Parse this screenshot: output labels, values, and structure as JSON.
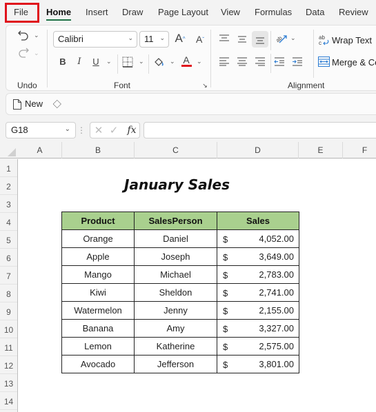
{
  "menu": {
    "tabs": [
      {
        "label": "File",
        "active": false,
        "highlighted": true
      },
      {
        "label": "Home",
        "active": true
      },
      {
        "label": "Insert"
      },
      {
        "label": "Draw"
      },
      {
        "label": "Page Layout"
      },
      {
        "label": "View"
      },
      {
        "label": "Formulas"
      },
      {
        "label": "Data"
      },
      {
        "label": "Review"
      }
    ],
    "highlight_color": "#e0121c",
    "active_underline_color": "#1e7145"
  },
  "ribbon": {
    "undo_group_label": "Undo",
    "font_group_label": "Font",
    "alignment_group_label": "Alignment",
    "font_name": "Calibri",
    "font_size": "11",
    "bold_label": "B",
    "italic_label": "I",
    "underline_label": "U",
    "font_color": "#e0121c",
    "wrap_text_label": "Wrap Text",
    "merge_label": "Merge & Ce"
  },
  "quickbar": {
    "new_label": "New"
  },
  "formula_bar": {
    "name_box": "G18",
    "formula_value": "",
    "fx_label": "fx"
  },
  "grid": {
    "columns": [
      "A",
      "B",
      "C",
      "D",
      "E",
      "F"
    ],
    "rows": [
      "1",
      "2",
      "3",
      "4",
      "5",
      "6",
      "7",
      "8",
      "9",
      "10",
      "11",
      "12",
      "13",
      "14"
    ]
  },
  "sheet": {
    "title": "January Sales",
    "header_color": "#a9d08e",
    "headers": [
      "Product",
      "SalesPerson",
      "Sales"
    ],
    "currency_symbol": "$",
    "rows": [
      {
        "product": "Orange",
        "salesperson": "Daniel",
        "sales": "4,052.00"
      },
      {
        "product": "Apple",
        "salesperson": "Joseph",
        "sales": "3,649.00"
      },
      {
        "product": "Mango",
        "salesperson": "Michael",
        "sales": "2,783.00"
      },
      {
        "product": "Kiwi",
        "salesperson": "Sheldon",
        "sales": "2,741.00"
      },
      {
        "product": "Watermelon",
        "salesperson": "Jenny",
        "sales": "2,155.00"
      },
      {
        "product": "Banana",
        "salesperson": "Amy",
        "sales": "3,327.00"
      },
      {
        "product": "Lemon",
        "salesperson": "Katherine",
        "sales": "2,575.00"
      },
      {
        "product": "Avocado",
        "salesperson": "Jefferson",
        "sales": "3,801.00"
      }
    ]
  }
}
